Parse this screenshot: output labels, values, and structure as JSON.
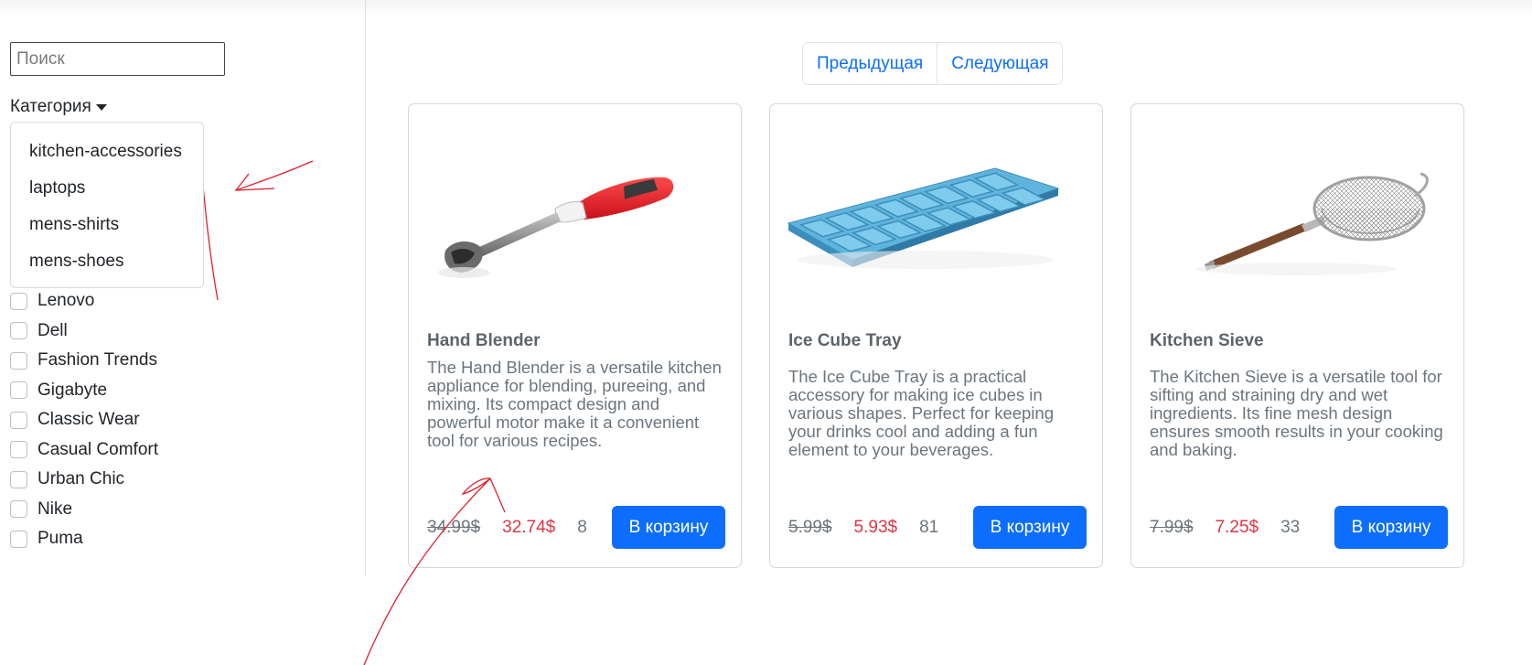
{
  "search": {
    "placeholder": "Поиск"
  },
  "filters": {
    "category_label": "Категория",
    "category_options": [
      "kitchen-accessories",
      "laptops",
      "mens-shirts",
      "mens-shoes"
    ],
    "brands": [
      "Lenovo",
      "Dell",
      "Fashion Trends",
      "Gigabyte",
      "Classic Wear",
      "Casual Comfort",
      "Urban Chic",
      "Nike",
      "Puma"
    ]
  },
  "pagination": {
    "prev_label": "Предыдущая",
    "next_label": "Следующая"
  },
  "products": [
    {
      "title": "Hand Blender",
      "description": "The Hand Blender is a versatile kitchen appliance for blending, pureeing, and mixing. Its compact design and powerful motor make it a convenient tool for various recipes.",
      "old_price": "34.99$",
      "price": "32.74$",
      "stock": "8",
      "cart_label": "В корзину",
      "image": "hand-blender"
    },
    {
      "title": "Ice Cube Tray",
      "description": "The Ice Cube Tray is a practical accessory for making ice cubes in various shapes. Perfect for keeping your drinks cool and adding a fun element to your beverages.",
      "old_price": "5.99$",
      "price": "5.93$",
      "stock": "81",
      "cart_label": "В корзину",
      "image": "ice-cube-tray"
    },
    {
      "title": "Kitchen Sieve",
      "description": "The Kitchen Sieve is a versatile tool for sifting and straining dry and wet ingredients. Its fine mesh design ensures smooth results in your cooking and baking.",
      "old_price": "7.99$",
      "price": "7.25$",
      "stock": "33",
      "cart_label": "В корзину",
      "image": "kitchen-sieve"
    }
  ],
  "colors": {
    "primary": "#0d6efd",
    "sale_price": "#dc3545",
    "muted": "#6c757d",
    "annotation": "#e0202a"
  }
}
